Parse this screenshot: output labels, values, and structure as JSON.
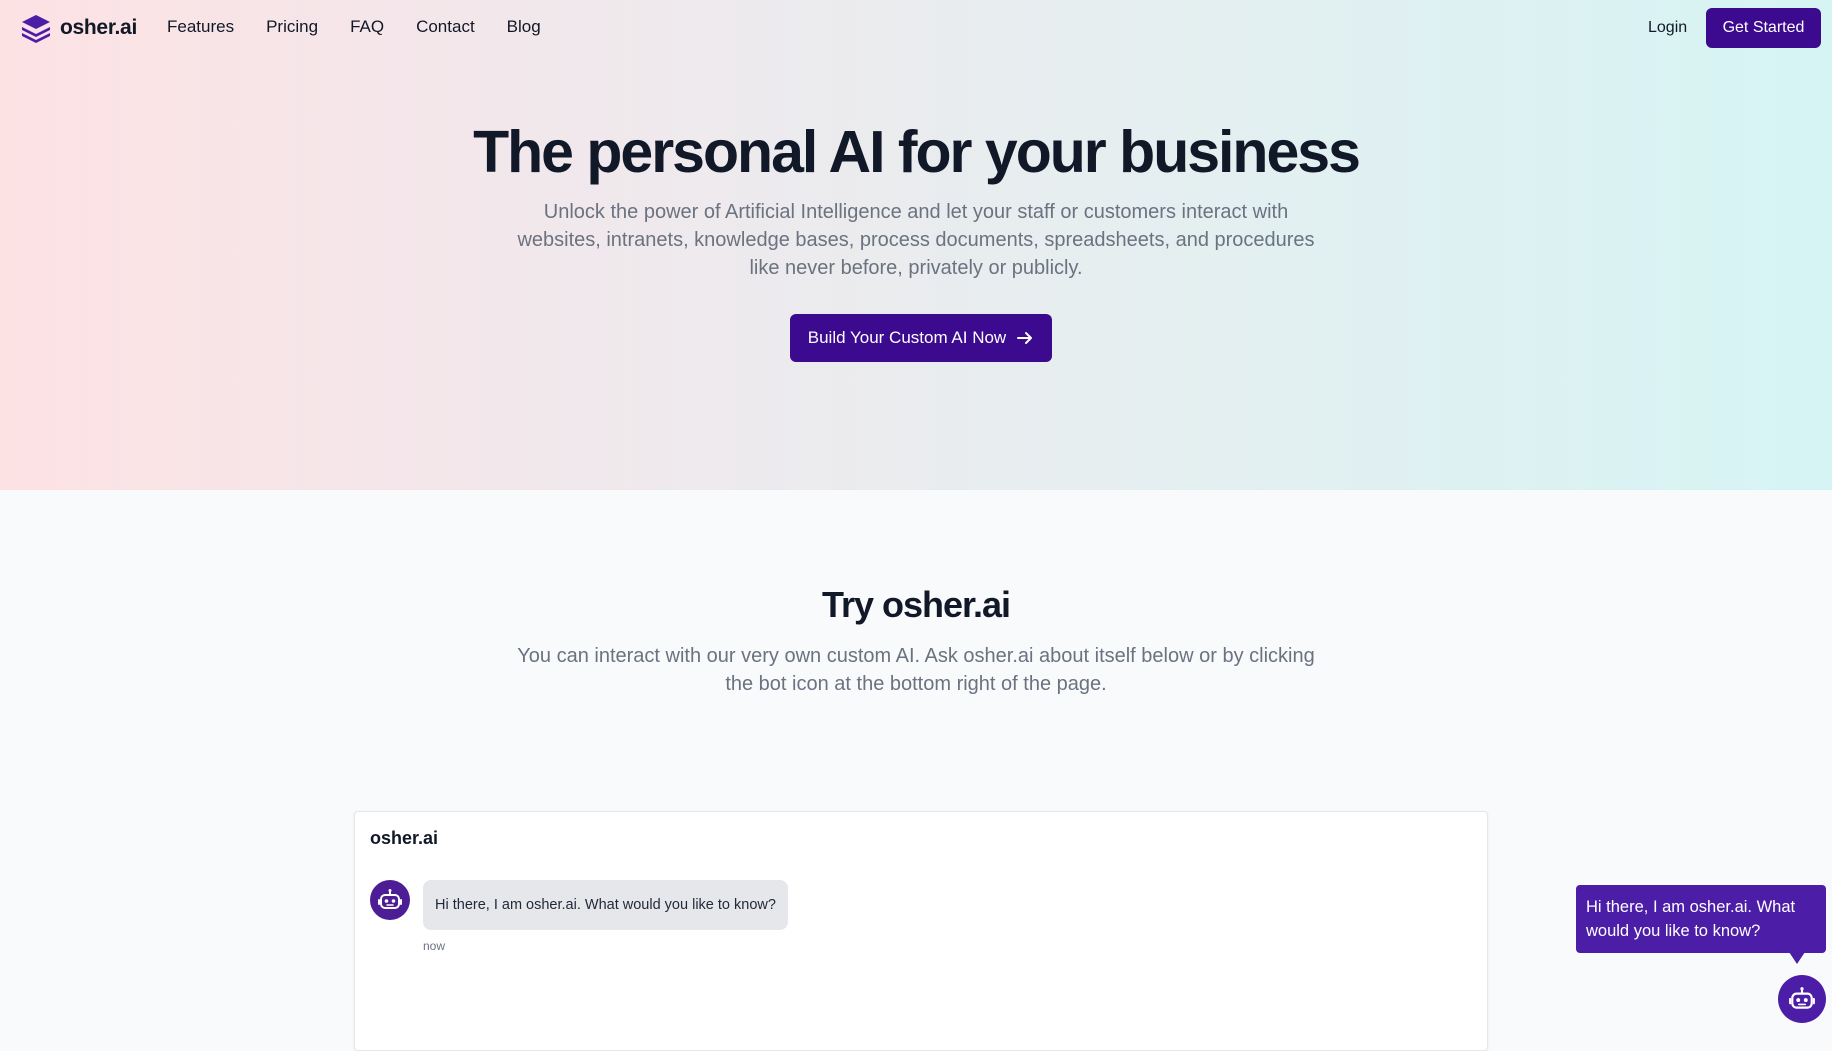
{
  "brand": {
    "name": "osher.ai",
    "accent": "#3b0a8f",
    "logo_icon": "stack-layers-icon"
  },
  "nav": {
    "links": [
      "Features",
      "Pricing",
      "FAQ",
      "Contact",
      "Blog"
    ],
    "login": "Login",
    "get_started": "Get Started"
  },
  "hero": {
    "title": "The personal AI for your business",
    "subtitle": "Unlock the power of Artificial Intelligence and let your staff or customers interact with websites, intranets, knowledge bases, process documents, spreadsheets, and procedures like never before, privately or publicly.",
    "cta_label": "Build Your Custom AI Now",
    "cta_icon": "arrow-right-icon"
  },
  "try_section": {
    "title": "Try osher.ai",
    "subtitle": "You can interact with our very own custom AI. Ask osher.ai about itself below or by clicking the bot icon at the bottom right of the page."
  },
  "chat": {
    "title": "osher.ai",
    "messages": [
      {
        "sender_icon": "robot-icon",
        "text": "Hi there, I am osher.ai. What would you like to know?",
        "time": "now"
      }
    ]
  },
  "widget": {
    "bubble_text": "Hi there, I am osher.ai. What would you like to know?",
    "button_icon": "robot-icon"
  }
}
